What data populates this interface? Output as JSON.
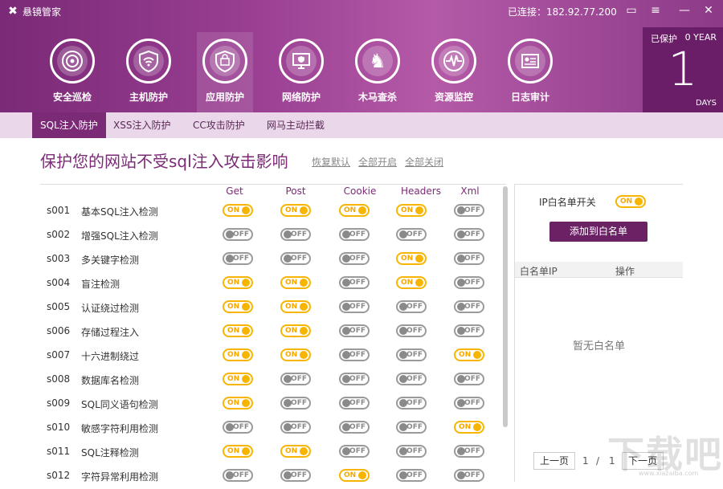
{
  "app": {
    "title": "悬镜管家",
    "connection": "已连接：182.92.77.200"
  },
  "window_buttons": [
    "▭",
    "≡",
    "—",
    "✕"
  ],
  "nav": [
    {
      "label": "安全巡检",
      "icon": "radar-icon"
    },
    {
      "label": "主机防护",
      "icon": "wifi-shield-icon"
    },
    {
      "label": "应用防护",
      "icon": "shield-icon",
      "active": true
    },
    {
      "label": "网络防护",
      "icon": "monitor-shield-icon"
    },
    {
      "label": "木马查杀",
      "icon": "horse-icon"
    },
    {
      "label": "资源监控",
      "icon": "pulse-icon"
    },
    {
      "label": "日志审计",
      "icon": "log-icon"
    }
  ],
  "protected": {
    "label": "已保护",
    "years": "0 YEAR",
    "days": "1",
    "days_label": "DAYS"
  },
  "subtabs": [
    "SQL注入防护",
    "XSS注入防护",
    "CC攻击防护",
    "网马主动拦截"
  ],
  "active_subtab": 0,
  "heading": "保护您的网站不受sql注入攻击影响",
  "links": {
    "restore": "恢复默认",
    "enable_all": "全部开启",
    "disable_all": "全部关闭"
  },
  "columns": [
    "Get",
    "Post",
    "Cookie",
    "Headers",
    "Xml"
  ],
  "toggle_text": {
    "on": "ON",
    "off": "OFF"
  },
  "rows": [
    {
      "code": "s001",
      "name": "基本SQL注入检测",
      "states": [
        true,
        true,
        true,
        true,
        false
      ]
    },
    {
      "code": "s002",
      "name": "增强SQL注入检测",
      "states": [
        false,
        false,
        false,
        false,
        false
      ]
    },
    {
      "code": "s003",
      "name": "多关键字检测",
      "states": [
        false,
        false,
        false,
        true,
        false
      ]
    },
    {
      "code": "s004",
      "name": "盲注检测",
      "states": [
        true,
        true,
        false,
        true,
        false
      ]
    },
    {
      "code": "s005",
      "name": "认证绕过检测",
      "states": [
        true,
        true,
        false,
        false,
        false
      ]
    },
    {
      "code": "s006",
      "name": "存储过程注入",
      "states": [
        true,
        true,
        false,
        false,
        false
      ]
    },
    {
      "code": "s007",
      "name": "十六进制绕过",
      "states": [
        true,
        true,
        false,
        false,
        true
      ]
    },
    {
      "code": "s008",
      "name": "数据库名检测",
      "states": [
        true,
        false,
        false,
        false,
        false
      ]
    },
    {
      "code": "s009",
      "name": "SQL同义语句检测",
      "states": [
        true,
        false,
        false,
        false,
        false
      ]
    },
    {
      "code": "s010",
      "name": "敏感字符利用检测",
      "states": [
        false,
        false,
        false,
        false,
        true
      ]
    },
    {
      "code": "s011",
      "name": "SQL注释检测",
      "states": [
        true,
        true,
        false,
        false,
        false
      ]
    },
    {
      "code": "s012",
      "name": "字符异常利用检测",
      "states": [
        false,
        false,
        true,
        false,
        false
      ]
    }
  ],
  "whitelist": {
    "switch_label": "IP白名单开关",
    "switch_on": true,
    "add_button": "添加到白名单",
    "col_ip": "白名单IP",
    "col_action": "操作",
    "empty": "暂无白名单"
  },
  "pagination": {
    "prev": "上一页",
    "current": "1",
    "sep": "/",
    "total": "1",
    "next": "下一页"
  },
  "watermark": {
    "text": "下载吧",
    "sub": "www.xiazaiba.com"
  }
}
